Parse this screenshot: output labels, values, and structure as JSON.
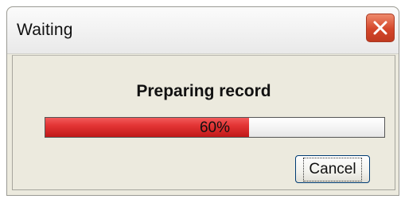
{
  "window": {
    "title": "Waiting",
    "close_icon": "close-icon"
  },
  "dialog": {
    "message": "Preparing record",
    "progress": {
      "value": 0.6,
      "label": "60%",
      "fill_color": "#e33535"
    },
    "cancel_label": "Cancel"
  }
}
